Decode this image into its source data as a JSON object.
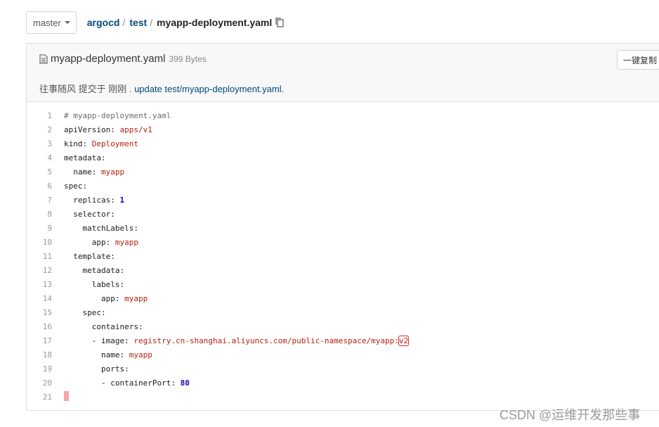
{
  "branch": {
    "label": "master"
  },
  "breadcrumb": {
    "owner": "argocd",
    "repo": "test",
    "file": "myapp-deployment.yaml",
    "sep": "/"
  },
  "file_header": {
    "name": "myapp-deployment.yaml",
    "size": "399 Bytes",
    "copy_all_label": "一键复制",
    "commit_prefix": "往事随风 提交于 刚刚 . ",
    "commit_message": "update test/myapp-deployment.yaml."
  },
  "code": {
    "lines": [
      {
        "n": "1",
        "indent": "",
        "comment": "# myapp-deployment.yaml"
      },
      {
        "n": "2",
        "indent": "",
        "key": "apiVersion",
        "value": "apps/v1",
        "vtype": "str"
      },
      {
        "n": "3",
        "indent": "",
        "key": "kind",
        "value": "Deployment",
        "vtype": "str"
      },
      {
        "n": "4",
        "indent": "",
        "key": "metadata"
      },
      {
        "n": "5",
        "indent": "  ",
        "key": "name",
        "value": "myapp",
        "vtype": "str"
      },
      {
        "n": "6",
        "indent": "",
        "key": "spec"
      },
      {
        "n": "7",
        "indent": "  ",
        "key": "replicas",
        "value": "1",
        "vtype": "num"
      },
      {
        "n": "8",
        "indent": "  ",
        "key": "selector"
      },
      {
        "n": "9",
        "indent": "    ",
        "key": "matchLabels"
      },
      {
        "n": "10",
        "indent": "      ",
        "key": "app",
        "value": "myapp",
        "vtype": "str"
      },
      {
        "n": "11",
        "indent": "  ",
        "key": "template"
      },
      {
        "n": "12",
        "indent": "    ",
        "key": "metadata"
      },
      {
        "n": "13",
        "indent": "      ",
        "key": "labels"
      },
      {
        "n": "14",
        "indent": "        ",
        "key": "app",
        "value": "myapp",
        "vtype": "str"
      },
      {
        "n": "15",
        "indent": "    ",
        "key": "spec"
      },
      {
        "n": "16",
        "indent": "      ",
        "key": "containers"
      },
      {
        "n": "17",
        "indent": "      ",
        "dash": true,
        "key": "image",
        "value": "registry.cn-shanghai.aliyuncs.com/public-namespace/myapp:",
        "vtype": "str",
        "highlight": "v2"
      },
      {
        "n": "18",
        "indent": "        ",
        "key": "name",
        "value": "myapp",
        "vtype": "str"
      },
      {
        "n": "19",
        "indent": "        ",
        "key": "ports"
      },
      {
        "n": "20",
        "indent": "        ",
        "dash": true,
        "key": "containerPort",
        "value": "80",
        "vtype": "num"
      },
      {
        "n": "21",
        "indent": "",
        "cursor": true
      }
    ]
  },
  "watermark": "CSDN @运维开发那些事",
  "colors": {
    "link": "#004a7a",
    "string": "#b5200d",
    "number": "#1c00cf",
    "highlight_box": "#d12a2a"
  }
}
